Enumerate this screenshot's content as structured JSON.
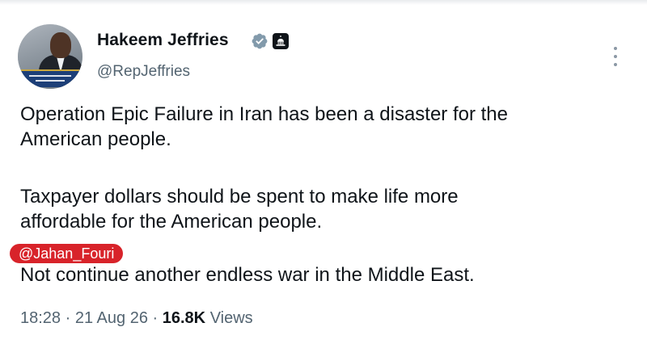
{
  "author": {
    "name": "Hakeem Jeffries",
    "handle": "@RepJeffries",
    "avatar_icon": "profile-photo",
    "verified_icon": "verified-badge-icon",
    "affiliation_icon": "us-capitol-icon",
    "colors": {
      "verified_badge": "#829aab",
      "affiliation_badge": "#0f1419"
    }
  },
  "tweet": {
    "paragraphs": [
      "Operation Epic Failure in Iran has been a disaster for the",
      "American people.",
      "Taxpayer dollars should be spent to make life more",
      "affordable for the American people.",
      "Not continue another endless war in the Middle East."
    ]
  },
  "watermark": {
    "text": "@Jahan_Fouri",
    "color": "#d8232a"
  },
  "meta": {
    "time": "18:28",
    "separator": "·",
    "date": "21 Aug 26",
    "views_count": "16.8K",
    "views_label": "Views"
  },
  "menu": {
    "icon": "more-vertical-icon"
  }
}
